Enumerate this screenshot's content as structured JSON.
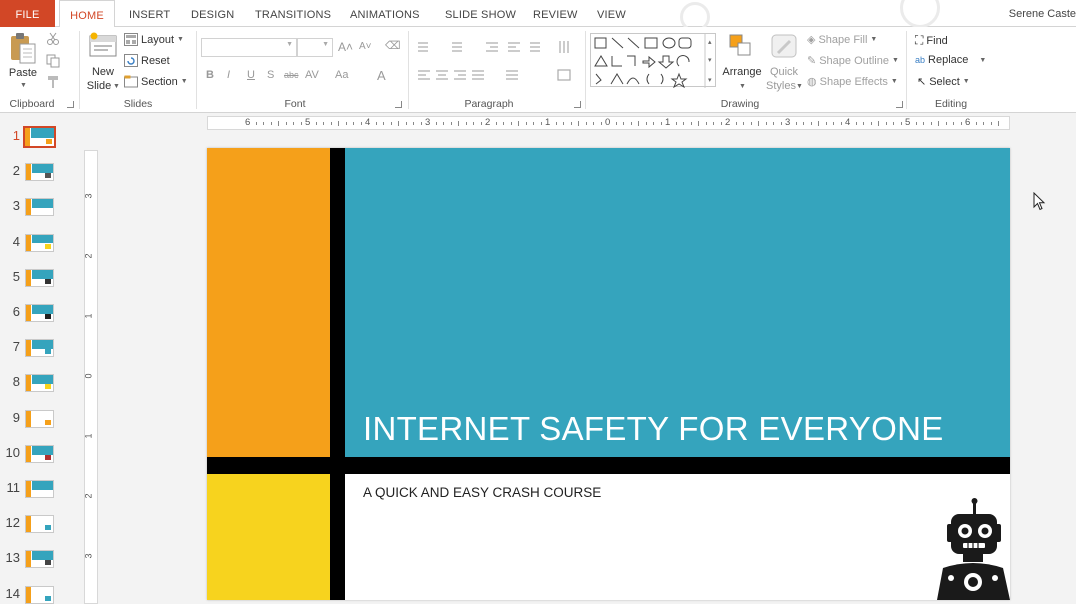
{
  "tabs": {
    "file": "FILE",
    "home": "HOME",
    "insert": "INSERT",
    "design": "DESIGN",
    "transitions": "TRANSITIONS",
    "animations": "ANIMATIONS",
    "slideshow": "SLIDE SHOW",
    "review": "REVIEW",
    "view": "VIEW"
  },
  "user": {
    "name": "Serene Caste"
  },
  "ribbon": {
    "clipboard": {
      "paste": "Paste",
      "label": "Clipboard"
    },
    "slides": {
      "new_slide_1": "New",
      "new_slide_2": "Slide",
      "layout": "Layout",
      "reset": "Reset",
      "section": "Section",
      "label": "Slides"
    },
    "font": {
      "label": "Font"
    },
    "paragraph": {
      "label": "Paragraph"
    },
    "drawing": {
      "arrange": "Arrange",
      "quick_styles_1": "Quick",
      "quick_styles_2": "Styles",
      "shape_fill": "Shape Fill",
      "shape_outline": "Shape Outline",
      "shape_effects": "Shape Effects",
      "label": "Drawing"
    },
    "editing": {
      "find": "Find",
      "replace": "Replace",
      "select": "Select",
      "label": "Editing"
    }
  },
  "ruler": {
    "horizontal": [
      "6",
      "5",
      "4",
      "3",
      "2",
      "1",
      "0",
      "1",
      "2",
      "3",
      "4",
      "5",
      "6"
    ],
    "vertical": [
      "3",
      "2",
      "1",
      "0",
      "1",
      "2",
      "3"
    ]
  },
  "thumbnails": [
    "1",
    "2",
    "3",
    "4",
    "5",
    "6",
    "7",
    "8",
    "9",
    "10",
    "11",
    "12",
    "13",
    "14"
  ],
  "selected_slide": "1",
  "slide": {
    "title": "INTERNET SAFETY FOR EVERYONE",
    "subtitle": "A QUICK AND EASY CRASH COURSE"
  },
  "colors": {
    "accent": "#d24726",
    "orange": "#f5a01a",
    "yellow": "#f7d31e",
    "teal": "#35a4bd"
  }
}
